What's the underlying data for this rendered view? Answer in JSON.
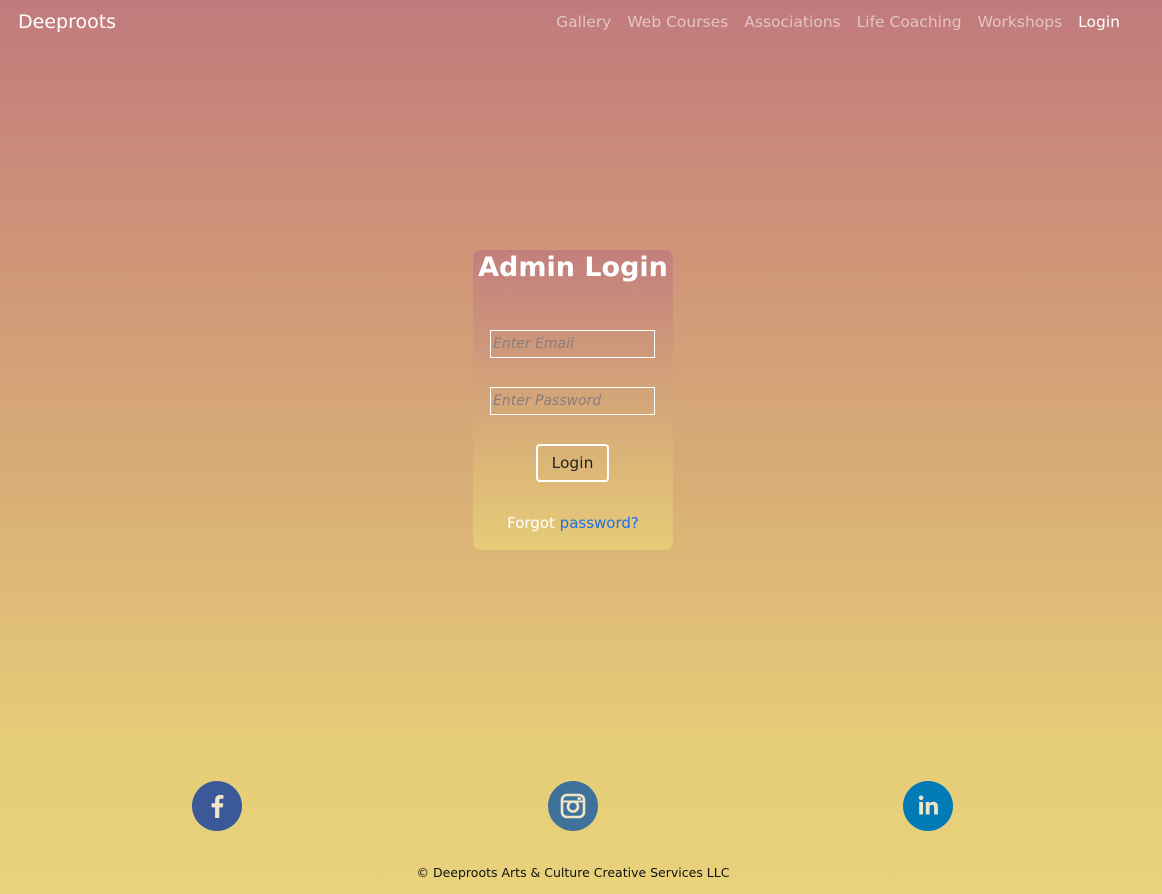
{
  "navbar": {
    "brand": "Deeproots",
    "links": [
      {
        "label": "Gallery"
      },
      {
        "label": "Web Courses"
      },
      {
        "label": "Associations"
      },
      {
        "label": "Life Coaching"
      },
      {
        "label": "Workshops"
      },
      {
        "label": "Login",
        "active": true
      }
    ]
  },
  "login": {
    "title": "Admin Login",
    "email_placeholder": "Enter Email",
    "email_value": "",
    "password_placeholder": "Enter Password",
    "password_value": "",
    "button_label": "Login",
    "forgot_text": "Forgot",
    "forgot_link": "password?"
  },
  "social": [
    {
      "name": "facebook",
      "icon": "facebook-icon",
      "color": "#3b5998"
    },
    {
      "name": "instagram",
      "icon": "instagram-icon",
      "color": "#3f729b"
    },
    {
      "name": "linkedin",
      "icon": "linkedin-icon",
      "color": "#007bb5"
    }
  ],
  "footer": {
    "copyright": "© Deeproots Arts & Culture Creative Services LLC"
  },
  "colors": {
    "gradient_top": "#c07a7c",
    "gradient_bottom": "#e8d27a",
    "link_blue": "#1e6fe8"
  }
}
